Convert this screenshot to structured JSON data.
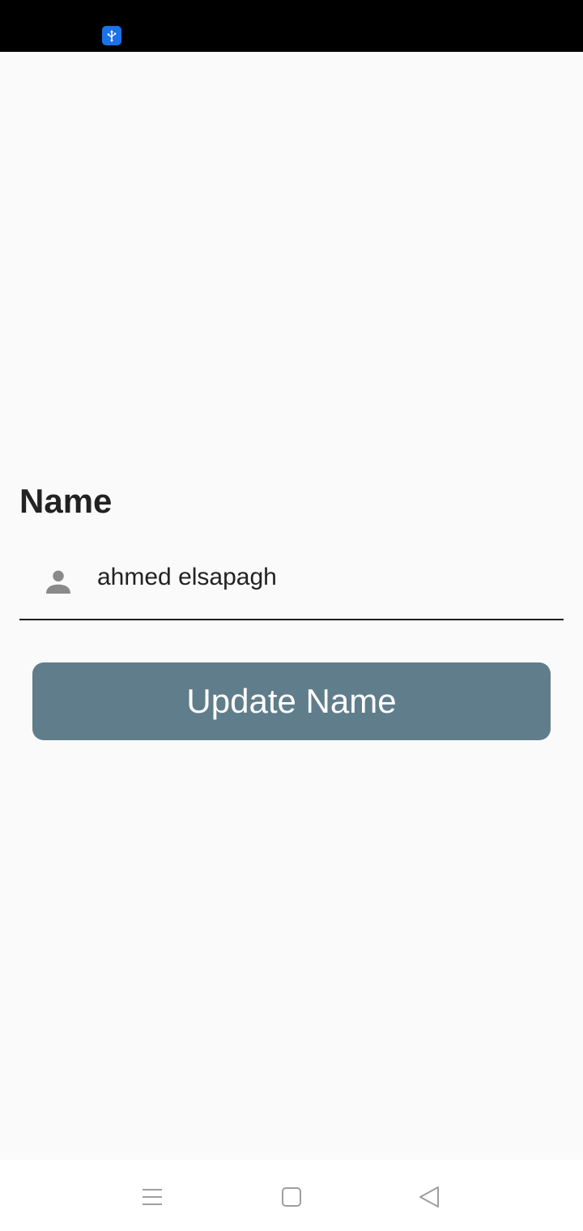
{
  "status_bar": {
    "icons": [
      "usb-icon"
    ],
    "badge_color": "#1a73e8"
  },
  "form": {
    "heading": "Name",
    "input_icon": "person-icon",
    "input_value": "ahmed elsapagh"
  },
  "update_button": {
    "label": "Update Name",
    "color": "#607d8b"
  },
  "nav_bar": {
    "buttons": [
      "menu-icon",
      "home-icon",
      "back-icon"
    ]
  }
}
